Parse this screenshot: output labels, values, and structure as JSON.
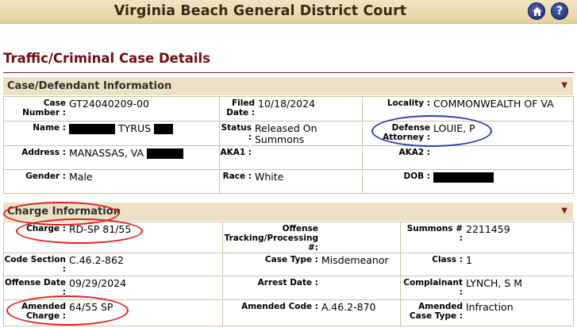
{
  "header": {
    "court_name": "Virginia Beach General District Court"
  },
  "icons": {
    "home": "home-icon",
    "help": "help-icon",
    "help_glyph": "?",
    "collapse": "triangle-down-icon",
    "collapse_glyph": "▼"
  },
  "page": {
    "title": "Traffic/Criminal Case Details"
  },
  "case_section": {
    "title": "Case/Defendant Information",
    "case_number_label": "Case Number :",
    "case_number": "GT24040209-00",
    "filed_label": "Filed Date :",
    "filed": "10/18/2024",
    "locality_label": "Locality :",
    "locality": "COMMONWEALTH OF VA",
    "name_label": "Name :",
    "name": "TYRUS",
    "status_label": "Status :",
    "status": "Released On Summons",
    "defense_label": "Defense Attorney :",
    "defense": "LOUIE, P",
    "address_label": "Address :",
    "address": "MANASSAS, VA",
    "aka1_label": "AKA1 :",
    "aka1": "",
    "aka2_label": "AKA2 :",
    "aka2": "",
    "gender_label": "Gender :",
    "gender": "Male",
    "race_label": "Race :",
    "race": "White",
    "dob_label": "DOB :",
    "dob": ""
  },
  "charge_section": {
    "title": "Charge Information",
    "charge_label": "Charge :",
    "charge": "RD-SP 81/55",
    "offense_tracking_label": "Offense Tracking/Processing #:",
    "offense_tracking": "",
    "summons_label": "Summons # :",
    "summons": "2211459",
    "code_section_label": "Code Section :",
    "code_section": "C.46.2-862",
    "case_type_label": "Case Type :",
    "case_type": "Misdemeanor",
    "class_label": "Class :",
    "class": "1",
    "offense_date_label": "Offense Date :",
    "offense_date": "09/29/2024",
    "arrest_date_label": "Arrest Date :",
    "arrest_date": "",
    "complainant_label": "Complainant :",
    "complainant": "LYNCH, S M",
    "amended_charge_label": "Amended Charge :",
    "amended_charge": "64/55 SP",
    "amended_code_label": "Amended Code :",
    "amended_code": "A.46.2-870",
    "amended_case_type_label": "Amended Case Type :",
    "amended_case_type": "Infraction"
  },
  "annotation_colors": {
    "red": "#e0201f",
    "blue": "#2e3cb6"
  }
}
